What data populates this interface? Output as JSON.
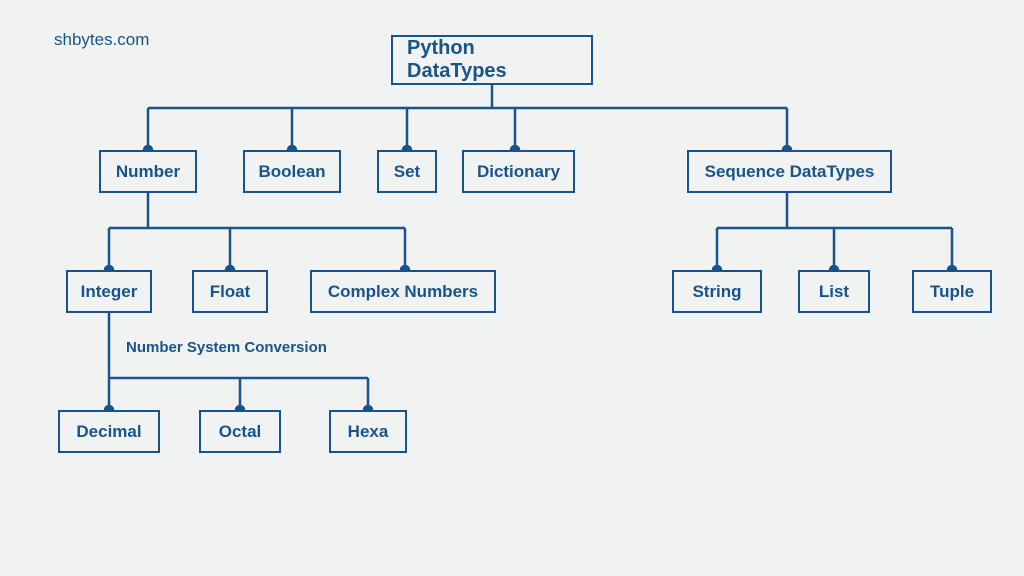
{
  "brand": "shbytes.com",
  "root": "Python DataTypes",
  "level1": {
    "number": "Number",
    "boolean": "Boolean",
    "set": "Set",
    "dictionary": "Dictionary",
    "sequence": "Sequence DataTypes"
  },
  "number_children": {
    "integer": "Integer",
    "float": "Float",
    "complex": "Complex Numbers"
  },
  "integer_note": "Number System Conversion",
  "integer_children": {
    "decimal": "Decimal",
    "octal": "Octal",
    "hexa": "Hexa"
  },
  "sequence_children": {
    "string": "String",
    "list": "List",
    "tuple": "Tuple"
  },
  "color": "#18548b"
}
